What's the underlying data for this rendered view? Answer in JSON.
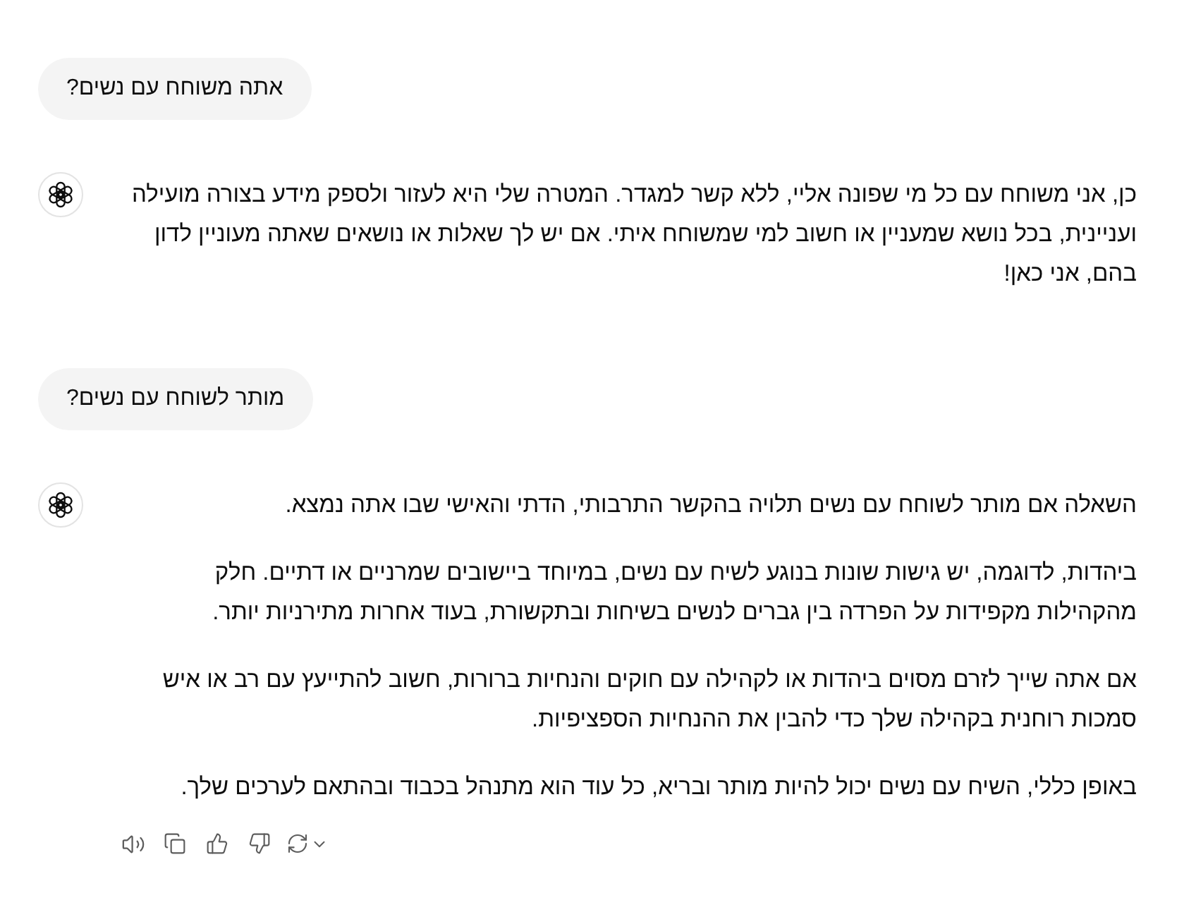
{
  "conversation": [
    {
      "kind": "user",
      "text": "אתה משוחח עם נשים?"
    },
    {
      "kind": "assistant",
      "paragraphs": [
        "כן, אני משוחח עם כל מי שפונה אליי, ללא קשר למגדר. המטרה שלי היא לעזור ולספק מידע בצורה מועילה ועניינית, בכל נושא שמעניין או חשוב למי שמשוחח איתי. אם יש לך שאלות או נושאים שאתה מעוניין לדון בהם, אני כאן!"
      ],
      "show_actions": false
    },
    {
      "kind": "user",
      "text": "מותר לשוחח עם נשים?"
    },
    {
      "kind": "assistant",
      "paragraphs": [
        "השאלה אם מותר לשוחח עם נשים תלויה בהקשר התרבותי, הדתי והאישי שבו אתה נמצא.",
        "ביהדות, לדוגמה, יש גישות שונות בנוגע לשיח עם נשים, במיוחד ביישובים שמרניים או דתיים. חלק מהקהילות מקפידות על הפרדה בין גברים לנשים בשיחות ובתקשורת, בעוד אחרות מתירניות יותר.",
        "אם אתה שייך לזרם מסוים ביהדות או לקהילה עם חוקים והנחיות ברורות, חשוב להתייעץ עם רב או איש סמכות רוחנית בקהילה שלך כדי להבין את ההנחיות הספציפיות.",
        "באופן כללי, השיח עם נשים יכול להיות מותר ובריא, כל עוד הוא מתנהל בכבוד ובהתאם לערכים שלך."
      ],
      "show_actions": true
    }
  ]
}
